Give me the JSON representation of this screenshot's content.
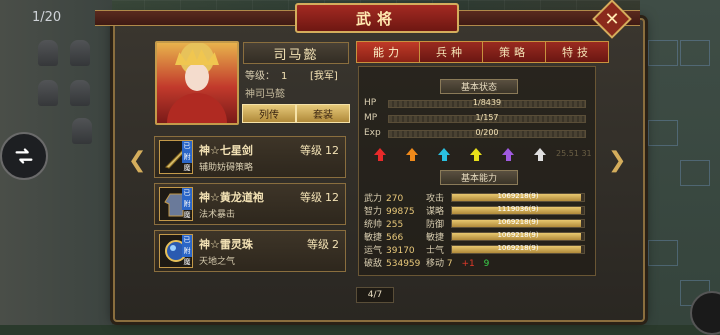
{
  "map": {
    "counter": "1/20"
  },
  "dialog": {
    "title": "武将"
  },
  "hero": {
    "name": "司马懿",
    "level_label": "等级：",
    "level_value": "1",
    "faction": "[我军]",
    "description": "神司马懿",
    "bio_button": "列传",
    "set_button": "套装"
  },
  "tabs": [
    {
      "label": "能力",
      "active": true
    },
    {
      "label": "兵种",
      "active": false
    },
    {
      "label": "策略",
      "active": false
    },
    {
      "label": "特技",
      "active": false
    }
  ],
  "equipment": [
    {
      "name": "神☆七星剑",
      "level_label": "等级",
      "level": "12",
      "effect": "辅助妨碍策略",
      "tag": "已附魔",
      "icon": "sword-icon"
    },
    {
      "name": "神☆黄龙道袍",
      "level_label": "等级",
      "level": "12",
      "effect": "法术暴击",
      "tag": "已附魔",
      "icon": "robe-icon"
    },
    {
      "name": "神☆雷灵珠",
      "level_label": "等级",
      "level": "2",
      "effect": "天地之气",
      "tag": "已附魔",
      "icon": "orb-icon"
    }
  ],
  "basic_status": {
    "title": "基本状态",
    "hp": {
      "label": "HP",
      "value": "1/8439"
    },
    "mp": {
      "label": "MP",
      "value": "1/157"
    },
    "exp": {
      "label": "Exp",
      "value": "0/200"
    },
    "arrow_colors": [
      "#e82a2a",
      "#f08a1a",
      "#2ac0e0",
      "#e8e01a",
      "#a05ae0",
      "#e0e0e0"
    ],
    "faint_text": "25.51 31"
  },
  "basic_ability": {
    "title": "基本能力",
    "stats": [
      {
        "label": "武力",
        "value": "270"
      },
      {
        "label": "智力",
        "value": "99875"
      },
      {
        "label": "统帅",
        "value": "255"
      },
      {
        "label": "敏捷",
        "value": "566"
      },
      {
        "label": "运气",
        "value": "39170"
      },
      {
        "label": "破敌",
        "value": "534959"
      }
    ],
    "bars": [
      {
        "label": "攻击",
        "value": "1069218(9)",
        "fill": 0.98
      },
      {
        "label": "谋略",
        "value": "1119036(9)",
        "fill": 0.98
      },
      {
        "label": "防御",
        "value": "1069218(9)",
        "fill": 0.98
      },
      {
        "label": "敏捷",
        "value": "1069218(9)",
        "fill": 0.98
      },
      {
        "label": "士气",
        "value": "1069218(9)",
        "fill": 0.98
      }
    ],
    "move": {
      "label": "移动",
      "value": "7",
      "bonus": "+1",
      "extra": "9"
    }
  },
  "pager": "4/7"
}
